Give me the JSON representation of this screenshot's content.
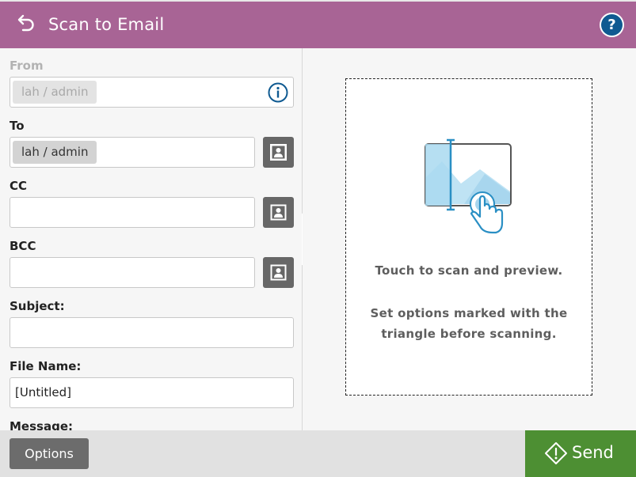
{
  "header": {
    "title": "Scan to Email",
    "back_icon": "back-arrow-icon",
    "help_icon": "help-icon",
    "help_symbol": "?",
    "color": "#a86495"
  },
  "form": {
    "from": {
      "label": "From",
      "value": "lah / admin",
      "disabled": true,
      "icon": "info-icon"
    },
    "to": {
      "label": "To",
      "value": "lah / admin",
      "icon": "address-book-icon"
    },
    "cc": {
      "label": "CC",
      "value": "",
      "icon": "address-book-icon"
    },
    "bcc": {
      "label": "BCC",
      "value": "",
      "icon": "address-book-icon"
    },
    "subject": {
      "label": "Subject:",
      "value": ""
    },
    "file_name": {
      "label": "File Name:",
      "value": "[Untitled]"
    },
    "message": {
      "label": "Message:"
    }
  },
  "preview": {
    "line1": "Touch to scan and preview.",
    "line2": "Set options marked with the",
    "line3": "triangle before scanning.",
    "icon": "scan-preview-icon",
    "accent": "#2a8fc4"
  },
  "bottombar": {
    "options_label": "Options",
    "send_label": "Send",
    "send_icon": "start-diamond-icon",
    "send_color": "#4d8f33"
  }
}
